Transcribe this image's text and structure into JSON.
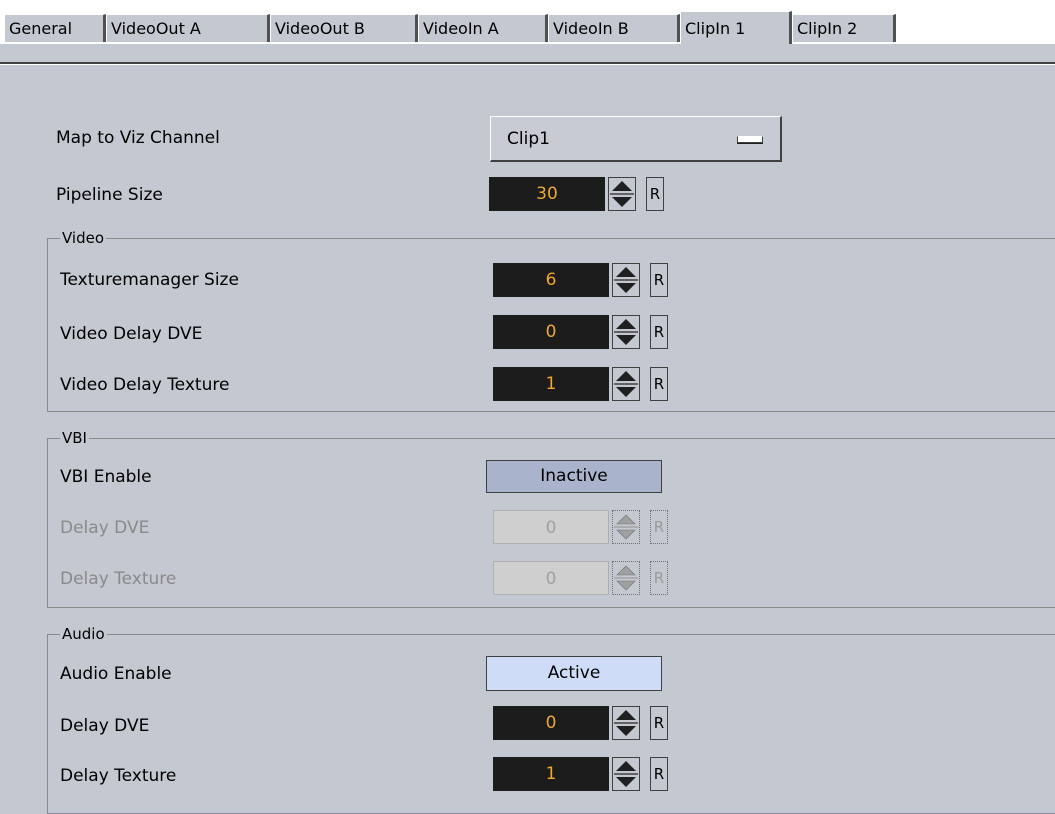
{
  "tabs": [
    "General",
    "VideoOut A",
    "VideoOut B",
    "VideoIn A",
    "VideoIn B",
    "ClipIn 1",
    "ClipIn 2"
  ],
  "active_tab": "ClipIn 1",
  "map_to_viz_channel": {
    "label": "Map to Viz Channel",
    "value": "Clip1"
  },
  "pipeline_size": {
    "label": "Pipeline Size",
    "value": "30",
    "reset": "R"
  },
  "video": {
    "legend": "Video",
    "texturemanager_size": {
      "label": "Texturemanager Size",
      "value": "6",
      "reset": "R"
    },
    "delay_dve": {
      "label": "Video Delay DVE",
      "value": "0",
      "reset": "R"
    },
    "delay_texture": {
      "label": "Video Delay Texture",
      "value": "1",
      "reset": "R"
    }
  },
  "vbi": {
    "legend": "VBI",
    "enable": {
      "label": "VBI Enable",
      "value": "Inactive"
    },
    "delay_dve": {
      "label": "Delay DVE",
      "value": "0",
      "reset": "R"
    },
    "delay_texture": {
      "label": "Delay Texture",
      "value": "0",
      "reset": "R"
    }
  },
  "audio": {
    "legend": "Audio",
    "enable": {
      "label": "Audio Enable",
      "value": "Active"
    },
    "delay_dve": {
      "label": "Delay DVE",
      "value": "0",
      "reset": "R"
    },
    "delay_texture": {
      "label": "Delay Texture",
      "value": "1",
      "reset": "R"
    }
  },
  "colors": {
    "panel": "#c4c8d0",
    "field_bg": "#1c1c1c",
    "field_text": "#f0a830",
    "inactive_toggle": "#a9b4cc",
    "active_toggle": "#cfdcf8"
  },
  "icons": {
    "spinner": "up-down-spinner-icon",
    "dropdown": "dropdown-bar-icon"
  }
}
